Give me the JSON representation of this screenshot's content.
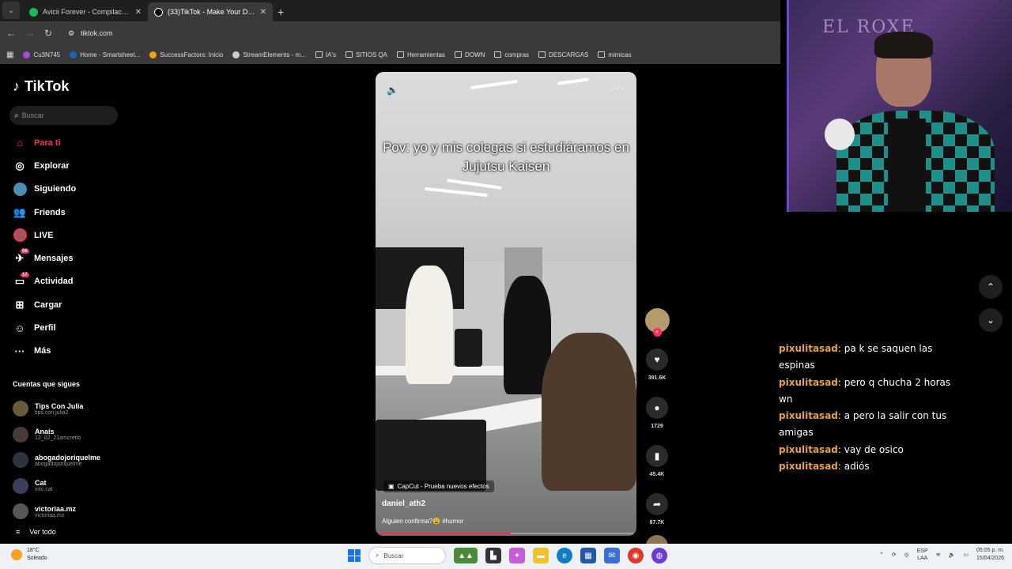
{
  "browser": {
    "tabs": [
      {
        "title": "Avicii Forever - Compilación de",
        "active": false
      },
      {
        "title": "(33)TikTok - Make Your Day",
        "active": true
      }
    ],
    "url": "tiktok.com",
    "bookmarks": [
      "Cu3N745",
      "Home - Smartsheet...",
      "SuccessFactors: Inicio",
      "StreamElements - m...",
      "IA's",
      "SITIOS QA",
      "Herramientas",
      "DOWN",
      "compras",
      "DESCARGAS",
      "mimicas"
    ]
  },
  "tiktok": {
    "logo": "TikTok",
    "search_placeholder": "Buscar",
    "nav": [
      {
        "label": "Para ti",
        "icon": "home-icon",
        "active": true,
        "badge": ""
      },
      {
        "label": "Explorar",
        "icon": "compass-icon",
        "active": false,
        "badge": ""
      },
      {
        "label": "Siguiendo",
        "icon": "following-icon",
        "active": false,
        "badge": ""
      },
      {
        "label": "Friends",
        "icon": "friends-icon",
        "active": false,
        "badge": ""
      },
      {
        "label": "LIVE",
        "icon": "live-icon",
        "active": false,
        "badge": ""
      },
      {
        "label": "Mensajes",
        "icon": "messages-icon",
        "active": false,
        "badge": "56"
      },
      {
        "label": "Actividad",
        "icon": "activity-icon",
        "active": false,
        "badge": "17"
      },
      {
        "label": "Cargar",
        "icon": "upload-icon",
        "active": false,
        "badge": ""
      },
      {
        "label": "Perfil",
        "icon": "profile-icon",
        "active": false,
        "badge": ""
      },
      {
        "label": "Más",
        "icon": "more-icon",
        "active": false,
        "badge": ""
      }
    ],
    "following_header": "Cuentas que sigues",
    "following": [
      {
        "name": "Tips Con Julia",
        "handle": "tips.con.julia2"
      },
      {
        "name": "Anaís",
        "handle": "12_02_21amcretto"
      },
      {
        "name": "abogadojoriquelme",
        "handle": "abogadojoriquelme"
      },
      {
        "name": "Cat",
        "handle": "mtc.cat"
      },
      {
        "name": "victoriaa.mz",
        "handle": "victoriaa.mz"
      }
    ],
    "see_all": "Ver todo",
    "video": {
      "caption": "Pov: yo y mis colegas si estudiáramos en Jujutsu Kaisen",
      "effect": "CapCut - Prueba nuevos efectos",
      "author": "daniel_ath2",
      "description": "Alguien confirma?😩 #humor",
      "progress": 0.52
    },
    "actions": {
      "likes": "391.6K",
      "comments": "1729",
      "saves": "45.4K",
      "shares": "87.7K"
    }
  },
  "stream": {
    "sign_text": "EL ROXE",
    "chat": [
      {
        "user": "pixulitasad",
        "message": "pa k se saquen las espinas"
      },
      {
        "user": "pixulitasad",
        "message": "pero q chucha 2 horas wn"
      },
      {
        "user": "pixulitasad",
        "message": "a pero la salir con tus amigas"
      },
      {
        "user": "pixulitasad",
        "message": "vay de osico"
      },
      {
        "user": "pixulitasad",
        "message": "adiós"
      }
    ]
  },
  "taskbar": {
    "temperature": "18°C",
    "weather": "Soleado",
    "search_placeholder": "Buscar",
    "language": "ESP",
    "region": "LAA",
    "time": "05:05 p. m.",
    "date": "15/04/2026"
  },
  "colors": {
    "accent": "#fe2c55",
    "chat_user": "#e8a23c",
    "webcam_border": "#6a47d9"
  }
}
